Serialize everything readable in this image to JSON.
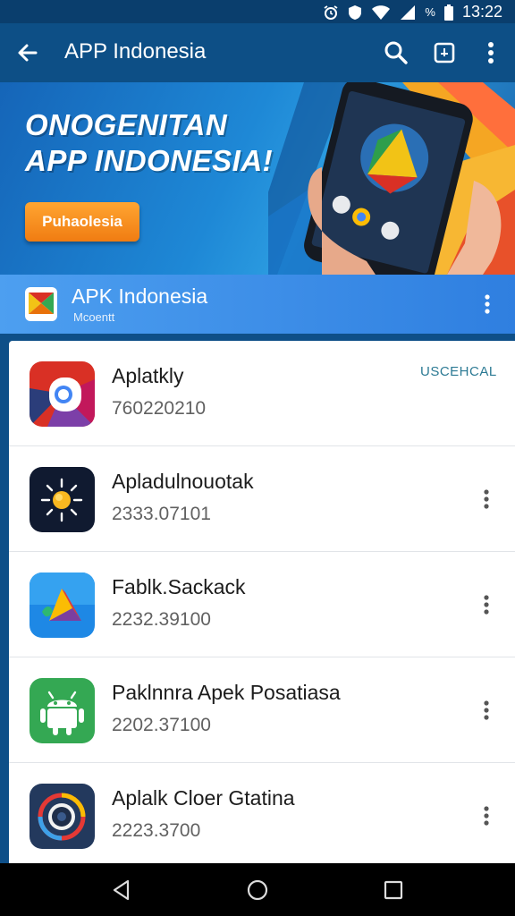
{
  "status_bar": {
    "time": "13:22",
    "icons": [
      "alarm-icon",
      "shield-icon",
      "wifi-icon",
      "signal-icon",
      "battery-icon"
    ],
    "battery_label": "%"
  },
  "app_bar": {
    "title": "APP Indonesia",
    "icons": [
      "back-arrow-icon",
      "search-icon",
      "box-icon",
      "more-vert-icon"
    ]
  },
  "banner": {
    "title": "ONOGENITAN APP INDONESIA!",
    "button_label": "Puhaolesia"
  },
  "source": {
    "name": "APK Indonesia",
    "subtitle": "Mcoentt"
  },
  "apps": [
    {
      "name": "Aplatkly",
      "meta": "760220210",
      "action": "USCEHCAL",
      "icon": "chrome-like-icon"
    },
    {
      "name": "Apladulnouotak",
      "meta": "2333.07101",
      "icon": "sun-icon"
    },
    {
      "name": "Fablk.Sackack",
      "meta": "2232.39100",
      "icon": "drive-like-icon"
    },
    {
      "name": "Paklnnra Apek Posatiasa",
      "meta": "2202.37100",
      "icon": "android-icon"
    },
    {
      "name": "Aplalk Cloer Gtatina",
      "meta": "2223.3700",
      "icon": "ring-icon"
    }
  ],
  "nav_bar": {
    "icons": [
      "nav-back-icon",
      "nav-home-icon",
      "nav-recents-icon"
    ]
  },
  "colors": {
    "app_bar": "#0d4f86",
    "status_bar": "#0a3e6d",
    "accent_orange": "#f07c12",
    "source_card": "#3a8ae6",
    "action_text": "#2c7a94"
  }
}
